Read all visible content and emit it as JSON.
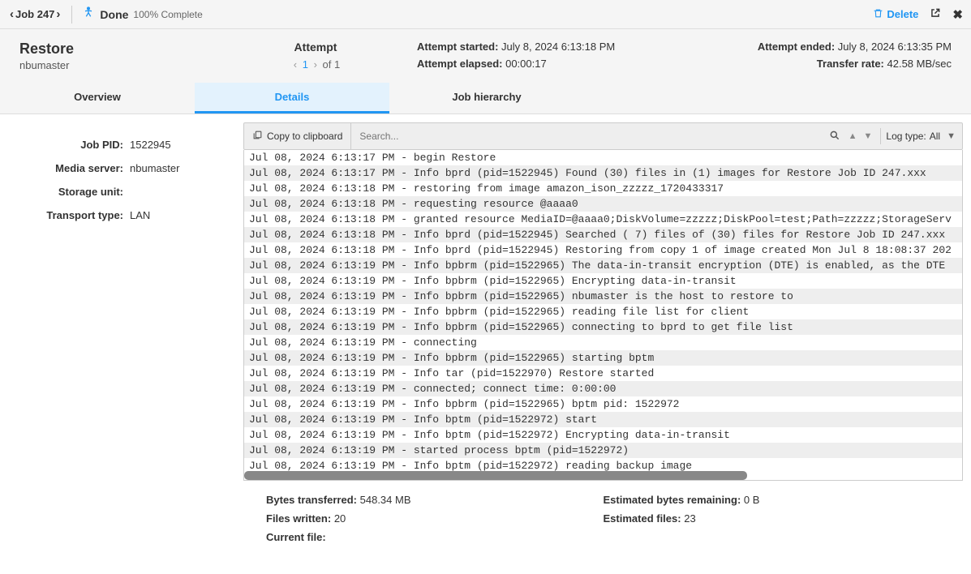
{
  "header": {
    "job_label": "Job 247",
    "status_text": "Done",
    "status_pct": "100% Complete",
    "delete_label": "Delete"
  },
  "summary": {
    "restore_title": "Restore",
    "restore_sub": "nbumaster",
    "attempt_label": "Attempt",
    "attempt_current": "1",
    "attempt_of": "of 1",
    "started_label": "Attempt started:",
    "started_val": "July 8, 2024 6:13:18 PM",
    "elapsed_label": "Attempt elapsed:",
    "elapsed_val": "00:00:17",
    "ended_label": "Attempt ended:",
    "ended_val": "July 8, 2024 6:13:35 PM",
    "rate_label": "Transfer rate:",
    "rate_val": "42.58 MB/sec"
  },
  "tabs": {
    "overview": "Overview",
    "details": "Details",
    "hierarchy": "Job hierarchy"
  },
  "side": {
    "pid_label": "Job PID:",
    "pid_val": "1522945",
    "media_label": "Media server:",
    "media_val": "nbumaster",
    "storage_label": "Storage unit:",
    "storage_val": "",
    "transport_label": "Transport type:",
    "transport_val": "LAN"
  },
  "toolbar": {
    "copy_label": "Copy to clipboard",
    "search_placeholder": "Search...",
    "logtype_label": "Log type:",
    "logtype_val": "All"
  },
  "logs": [
    "Jul 08, 2024 6:13:17 PM - begin Restore",
    "Jul 08, 2024 6:13:17 PM - Info bprd (pid=1522945) Found (30) files in (1) images for Restore Job ID 247.xxx",
    "Jul 08, 2024 6:13:18 PM - restoring from image amazon_ison_zzzzz_1720433317",
    "Jul 08, 2024 6:13:18 PM - requesting resource @aaaa0",
    "Jul 08, 2024 6:13:18 PM - granted resource MediaID=@aaaa0;DiskVolume=zzzzz;DiskPool=test;Path=zzzzz;StorageServ",
    "Jul 08, 2024 6:13:18 PM - Info bprd (pid=1522945) Searched ( 7) files of (30) files for Restore Job ID 247.xxx",
    "Jul 08, 2024 6:13:18 PM - Info bprd (pid=1522945) Restoring from copy 1 of image created Mon Jul 8 18:08:37 202",
    "Jul 08, 2024 6:13:19 PM - Info bpbrm (pid=1522965) The data-in-transit encryption (DTE) is enabled, as the DTE",
    "Jul 08, 2024 6:13:19 PM - Info bpbrm (pid=1522965) Encrypting data-in-transit",
    "Jul 08, 2024 6:13:19 PM - Info bpbrm (pid=1522965) nbumaster is the host to restore to",
    "Jul 08, 2024 6:13:19 PM - Info bpbrm (pid=1522965) reading file list for client",
    "Jul 08, 2024 6:13:19 PM - Info bpbrm (pid=1522965) connecting to bprd to get file list",
    "Jul 08, 2024 6:13:19 PM - connecting",
    "Jul 08, 2024 6:13:19 PM - Info bpbrm (pid=1522965) starting bptm",
    "Jul 08, 2024 6:13:19 PM - Info tar (pid=1522970) Restore started",
    "Jul 08, 2024 6:13:19 PM - connected; connect time: 0:00:00",
    "Jul 08, 2024 6:13:19 PM - Info bpbrm (pid=1522965) bptm pid: 1522972",
    "Jul 08, 2024 6:13:19 PM - Info bptm (pid=1522972) start",
    "Jul 08, 2024 6:13:19 PM - Info bptm (pid=1522972) Encrypting data-in-transit",
    "Jul 08, 2024 6:13:19 PM - started process bptm (pid=1522972)",
    "Jul 08, 2024 6:13:19 PM - Info bptm (pid=1522972) reading backup image"
  ],
  "footer": {
    "bytes_label": "Bytes transferred:",
    "bytes_val": "548.34 MB",
    "files_label": "Files written:",
    "files_val": "20",
    "current_label": "Current file:",
    "current_val": "",
    "est_bytes_label": "Estimated bytes remaining:",
    "est_bytes_val": "0 B",
    "est_files_label": "Estimated files:",
    "est_files_val": "23"
  }
}
